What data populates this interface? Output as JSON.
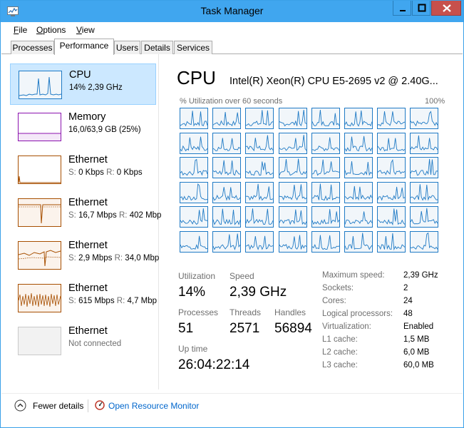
{
  "window": {
    "title": "Task Manager"
  },
  "menu": [
    {
      "label": "File",
      "accel": "F",
      "rest": "ile"
    },
    {
      "label": "Options",
      "accel": "O",
      "rest": "ptions"
    },
    {
      "label": "View",
      "accel": "V",
      "rest": "iew"
    }
  ],
  "tabs": [
    "Processes",
    "Performance",
    "Users",
    "Details",
    "Services"
  ],
  "active_tab": "Performance",
  "sidebar": [
    {
      "title": "CPU",
      "sub": "14% 2,39 GHz",
      "selected": true,
      "color": "#1f7ac5"
    },
    {
      "title": "Memory",
      "sub": "16,0/63,9 GB (25%)",
      "color": "#8b12ae"
    },
    {
      "title": "Ethernet",
      "s_label": "S:",
      "s": "0 Kbps",
      "r_label": "R:",
      "r": "0 Kbps",
      "color": "#a74f01"
    },
    {
      "title": "Ethernet",
      "s_label": "S:",
      "s": "16,7 Mbps",
      "r_label": "R:",
      "r": "402 Mbp",
      "color": "#a74f01"
    },
    {
      "title": "Ethernet",
      "s_label": "S:",
      "s": "2,9 Mbps",
      "r_label": "R:",
      "r": "34,0 Mbp",
      "color": "#a74f01"
    },
    {
      "title": "Ethernet",
      "s_label": "S:",
      "s": "615 Mbps",
      "r_label": "R:",
      "r": "4,7 Mbp",
      "color": "#a74f01"
    },
    {
      "title": "Ethernet",
      "sub": "Not connected",
      "color": "#a74f01"
    }
  ],
  "main": {
    "title": "CPU",
    "cpu_name": "Intel(R) Xeon(R) CPU E5-2695 v2 @ 2.40G...",
    "graph_left_label": "% Utilization over 60 seconds",
    "graph_right_label": "100%",
    "logical_graph_count": 48
  },
  "stats": {
    "utilization_label": "Utilization",
    "utilization": "14%",
    "speed_label": "Speed",
    "speed": "2,39 GHz",
    "processes_label": "Processes",
    "processes": "51",
    "threads_label": "Threads",
    "threads": "2571",
    "handles_label": "Handles",
    "handles": "56894",
    "uptime_label": "Up time",
    "uptime": "26:04:22:14"
  },
  "specs": [
    {
      "label": "Maximum speed:",
      "value": "2,39 GHz"
    },
    {
      "label": "Sockets:",
      "value": "2"
    },
    {
      "label": "Cores:",
      "value": "24"
    },
    {
      "label": "Logical processors:",
      "value": "48"
    },
    {
      "label": "Virtualization:",
      "value": "Enabled"
    },
    {
      "label": "L1 cache:",
      "value": "1,5 MB"
    },
    {
      "label": "L2 cache:",
      "value": "6,0 MB"
    },
    {
      "label": "L3 cache:",
      "value": "60,0 MB"
    }
  ],
  "footer": {
    "fewer_details": "Fewer details",
    "resource_monitor": "Open Resource Monitor"
  },
  "colors": {
    "cpu": "#1f7ac5",
    "memory": "#8b12ae",
    "ethernet": "#a74f01",
    "titlebar": "#40a6ef",
    "close": "#c7504c"
  }
}
